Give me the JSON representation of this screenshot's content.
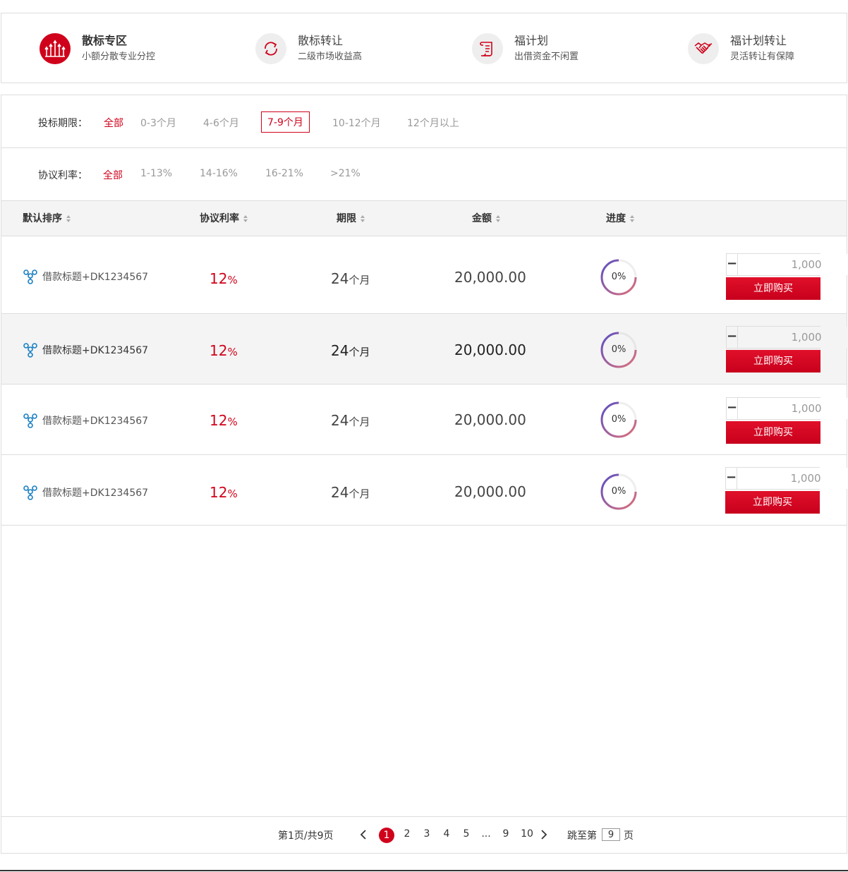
{
  "categories": [
    {
      "title": "散标专区",
      "sub": "小额分散专业分控",
      "icon": "bars-chart-icon",
      "active": true
    },
    {
      "title": "散标转让",
      "sub": "二级市场收益高",
      "icon": "cycle-arrows-icon",
      "active": false
    },
    {
      "title": "福计划",
      "sub": "出借资金不闲置",
      "icon": "scroll-icon",
      "active": false
    },
    {
      "title": "福计划转让",
      "sub": "灵活转让有保障",
      "icon": "handshake-icon",
      "active": false
    }
  ],
  "filters": {
    "term": {
      "label": "投标期限：",
      "options": [
        "全部",
        "0-3个月",
        "4-6个月",
        "7-9个月",
        "10-12个月",
        "12个月以上"
      ],
      "selected": "7-9个月"
    },
    "rate": {
      "label": "协议利率：",
      "options": [
        "全部",
        "1-13%",
        "14-16%",
        "16-21%",
        ">21%"
      ],
      "selected": "全部"
    }
  },
  "table": {
    "headers": [
      "默认排序",
      "协议利率",
      "期限",
      "金额",
      "进度"
    ],
    "rows": [
      {
        "title": "借款标题+DK1234567",
        "rate": "12",
        "rate_unit": "%",
        "term": "24",
        "term_unit": "个月",
        "amount": "20,000.00",
        "progress": "0%",
        "progress_value": 0,
        "qty": "1,000",
        "buy": "立即购买"
      },
      {
        "title": "借款标题+DK1234567",
        "rate": "12",
        "rate_unit": "%",
        "term": "24",
        "term_unit": "个月",
        "amount": "20,000.00",
        "progress": "0%",
        "progress_value": 0,
        "qty": "1,000",
        "buy": "立即购买"
      },
      {
        "title": "借款标题+DK1234567",
        "rate": "12",
        "rate_unit": "%",
        "term": "24",
        "term_unit": "个月",
        "amount": "20,000.00",
        "progress": "0%",
        "progress_value": 0,
        "qty": "1,000",
        "buy": "立即购买"
      },
      {
        "title": "借款标题+DK1234567",
        "rate": "12",
        "rate_unit": "%",
        "term": "24",
        "term_unit": "个月",
        "amount": "20,000.00",
        "progress": "0%",
        "progress_value": 0,
        "qty": "1,000",
        "buy": "立即购买"
      }
    ]
  },
  "pagination": {
    "summary": "第1页/共9页",
    "pages": [
      "1",
      "2",
      "3",
      "4",
      "5",
      "...",
      "9",
      "10"
    ],
    "current": "1",
    "jump_prefix": "跳至第",
    "jump_value": "9",
    "jump_suffix": "页"
  },
  "colors": {
    "accent": "#d0021b",
    "ring_start": "#5b4fc4",
    "ring_end": "#e0707a"
  }
}
